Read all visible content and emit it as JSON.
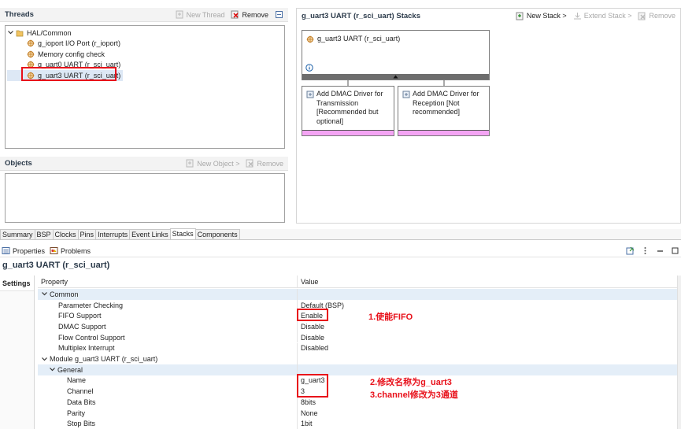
{
  "threads_panel": {
    "title": "Threads",
    "new_thread": "New Thread",
    "remove": "Remove",
    "tree": {
      "root": "HAL/Common",
      "items": [
        "g_ioport I/O Port (r_ioport)",
        "Memory config check",
        "g_uart0 UART (r_sci_uart)",
        "g_uart3 UART (r_sci_uart)"
      ]
    }
  },
  "objects_panel": {
    "title": "Objects",
    "new_object": "New Object >",
    "remove": "Remove"
  },
  "stacks_panel": {
    "title": "g_uart3 UART (r_sci_uart) Stacks",
    "new_stack": "New Stack >",
    "extend_stack": "Extend Stack >",
    "remove": "Remove",
    "main_module": "g_uart3 UART (r_sci_uart)",
    "sub_modules": [
      "Add DMAC Driver for Transmission [Recommended but optional]",
      "Add DMAC Driver for Reception [Not recommended]"
    ]
  },
  "editor_tabs": [
    "Summary",
    "BSP",
    "Clocks",
    "Pins",
    "Interrupts",
    "Event Links",
    "Stacks",
    "Components"
  ],
  "properties_view": {
    "tab_properties": "Properties",
    "tab_problems": "Problems",
    "title": "g_uart3 UART (r_sci_uart)",
    "side_tab": "Settings",
    "col_property": "Property",
    "col_value": "Value",
    "rows": [
      {
        "name": "Common",
        "value": ""
      },
      {
        "name": "Parameter Checking",
        "value": "Default (BSP)"
      },
      {
        "name": "FIFO Support",
        "value": "Enable"
      },
      {
        "name": "DMAC Support",
        "value": "Disable"
      },
      {
        "name": "Flow Control Support",
        "value": "Disable"
      },
      {
        "name": "Multiplex Interrupt",
        "value": "Disabled"
      },
      {
        "name": "Module g_uart3 UART (r_sci_uart)",
        "value": ""
      },
      {
        "name": "General",
        "value": ""
      },
      {
        "name": "Name",
        "value": "g_uart3"
      },
      {
        "name": "Channel",
        "value": "3"
      },
      {
        "name": "Data Bits",
        "value": "8bits"
      },
      {
        "name": "Parity",
        "value": "None"
      },
      {
        "name": "Stop Bits",
        "value": "1bit"
      }
    ]
  },
  "annotations": {
    "a1": "1.使能FIFO",
    "a2": "2.修改名称为g_uart3",
    "a3": "3.channel修改为3通道"
  },
  "colors": {
    "highlight_red": "#e8101a",
    "row_selected": "#e4eef8",
    "stack_bar": "#f4a4f4"
  }
}
